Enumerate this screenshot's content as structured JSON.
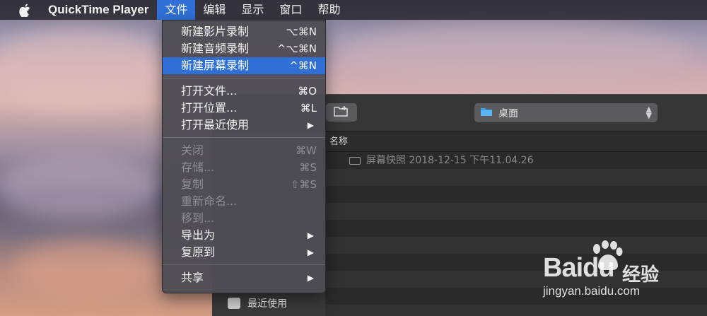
{
  "menubar": {
    "app_name": "QuickTime Player",
    "items": [
      "文件",
      "编辑",
      "显示",
      "窗口",
      "帮助"
    ]
  },
  "file_menu": {
    "group1": [
      {
        "label": "新建影片录制",
        "shortcut": "⌥⌘N"
      },
      {
        "label": "新建音频录制",
        "shortcut": "^⌥⌘N"
      },
      {
        "label": "新建屏幕录制",
        "shortcut": "^⌘N"
      }
    ],
    "group2": [
      {
        "label": "打开文件...",
        "shortcut": "⌘O"
      },
      {
        "label": "打开位置...",
        "shortcut": "⌘L"
      },
      {
        "label": "打开最近使用",
        "shortcut": "▶"
      }
    ],
    "group3": [
      {
        "label": "关闭",
        "shortcut": "⌘W"
      },
      {
        "label": "存储...",
        "shortcut": "⌘S"
      },
      {
        "label": "复制",
        "shortcut": "⇧⌘S"
      },
      {
        "label": "重新命名...",
        "shortcut": ""
      },
      {
        "label": "移到...",
        "shortcut": ""
      },
      {
        "label": "导出为",
        "shortcut": "▶"
      },
      {
        "label": "复原到",
        "shortcut": "▶"
      }
    ],
    "group4": [
      {
        "label": "共享",
        "shortcut": "▶"
      }
    ]
  },
  "finder": {
    "location": "桌面",
    "column_header": "名称",
    "file_name": "屏幕快照 2018-12-15 下午11.04.26",
    "sidebar_recent": "最近使用"
  },
  "watermark": {
    "logo": "Baidu",
    "cn": "经验",
    "url": "jingyan.baidu.com"
  },
  "colors": {
    "menu_highlight": "#2f6fd6",
    "menubar_bg": "#26242c"
  }
}
